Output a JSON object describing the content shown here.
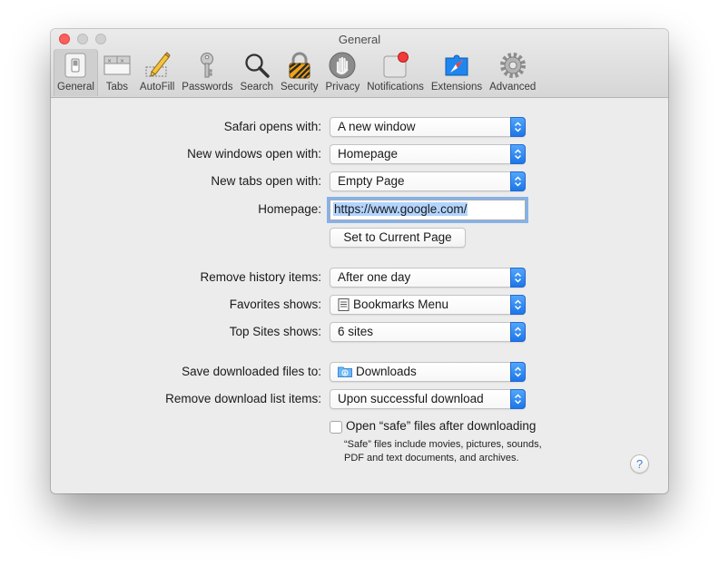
{
  "window": {
    "title": "General"
  },
  "toolbar": {
    "items": [
      {
        "label": "General",
        "icon": "general-switch-icon",
        "selected": true
      },
      {
        "label": "Tabs",
        "icon": "tabs-icon"
      },
      {
        "label": "AutoFill",
        "icon": "autofill-pencil-icon"
      },
      {
        "label": "Passwords",
        "icon": "key-icon"
      },
      {
        "label": "Search",
        "icon": "magnifier-icon"
      },
      {
        "label": "Security",
        "icon": "padlock-icon"
      },
      {
        "label": "Privacy",
        "icon": "hand-icon"
      },
      {
        "label": "Notifications",
        "icon": "notifications-icon"
      },
      {
        "label": "Extensions",
        "icon": "compass-icon"
      },
      {
        "label": "Advanced",
        "icon": "gear-icon"
      }
    ]
  },
  "settings": {
    "safari_opens_with": {
      "label": "Safari opens with:",
      "value": "A new window"
    },
    "new_windows_open_with": {
      "label": "New windows open with:",
      "value": "Homepage"
    },
    "new_tabs_open_with": {
      "label": "New tabs open with:",
      "value": "Empty Page"
    },
    "homepage": {
      "label": "Homepage:",
      "value": "https://www.google.com/"
    },
    "set_current_page_button": "Set to Current Page",
    "remove_history_items": {
      "label": "Remove history items:",
      "value": "After one day"
    },
    "favorites_shows": {
      "label": "Favorites shows:",
      "value": "Bookmarks Menu"
    },
    "top_sites_shows": {
      "label": "Top Sites shows:",
      "value": "6 sites"
    },
    "save_downloads_to": {
      "label": "Save downloaded files to:",
      "value": "Downloads"
    },
    "remove_download_list": {
      "label": "Remove download list items:",
      "value": "Upon successful download"
    },
    "open_safe_files": {
      "label": "Open “safe” files after downloading",
      "checked": false
    },
    "safe_files_note": "“Safe” files include movies, pictures, sounds, PDF and text documents, and archives."
  },
  "help_button": "?",
  "colors": {
    "accent": "#1c76e8",
    "close": "#fc605c",
    "notification_badge": "#f23b36",
    "selection": "#b3d4fc"
  }
}
